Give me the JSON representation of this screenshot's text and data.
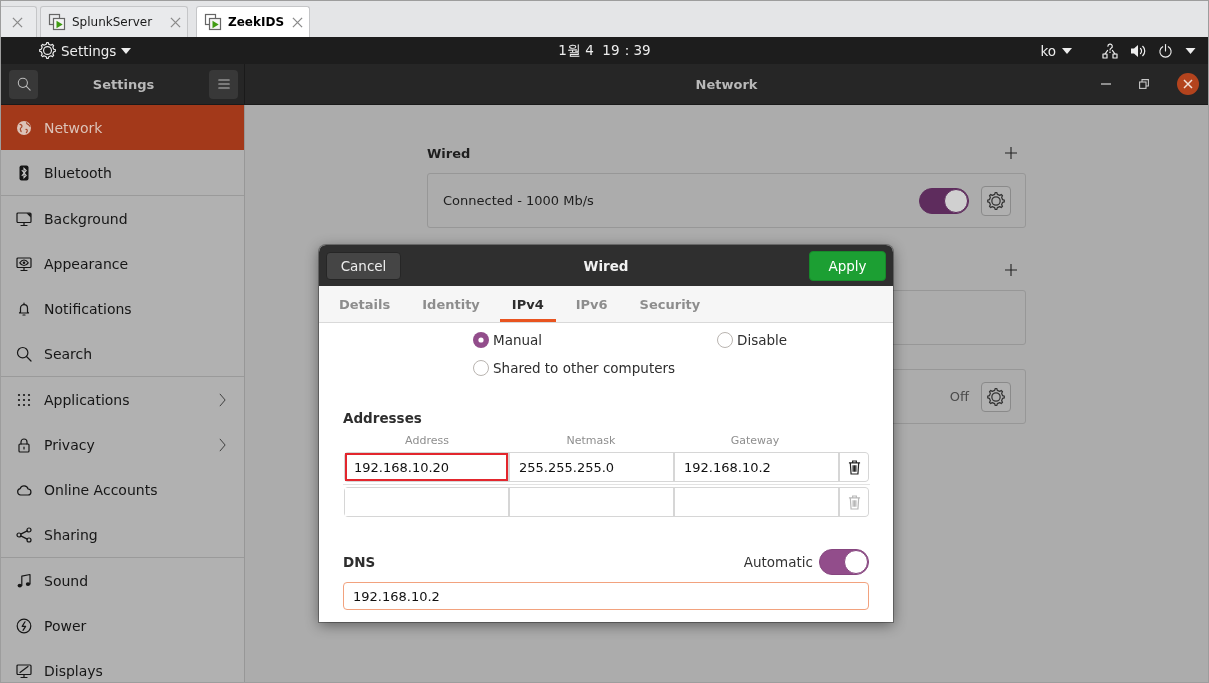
{
  "browser_tabs": [
    {
      "selected": false
    },
    {
      "label": "SplunkServer",
      "selected": false
    },
    {
      "label": "ZeekIDS",
      "selected": true
    }
  ],
  "top_bar": {
    "app_menu": "Settings",
    "clock": "1월 4  19：39",
    "keyboard_layout": "ko"
  },
  "settings": {
    "sidebar_title": "Settings",
    "page_title": "Network",
    "sidebar": {
      "groups": [
        {
          "items": [
            {
              "label": "Network",
              "selected": true,
              "has_submenu": false
            },
            {
              "label": "Bluetooth",
              "selected": false,
              "has_submenu": false
            }
          ]
        },
        {
          "items": [
            {
              "label": "Background",
              "selected": false,
              "has_submenu": false
            },
            {
              "label": "Appearance",
              "selected": false,
              "has_submenu": false
            },
            {
              "label": "Notifications",
              "selected": false,
              "has_submenu": false
            },
            {
              "label": "Search",
              "selected": false,
              "has_submenu": false
            }
          ]
        },
        {
          "items": [
            {
              "label": "Applications",
              "selected": false,
              "has_submenu": true
            },
            {
              "label": "Privacy",
              "selected": false,
              "has_submenu": true
            },
            {
              "label": "Online Accounts",
              "selected": false,
              "has_submenu": false
            },
            {
              "label": "Sharing",
              "selected": false,
              "has_submenu": false
            }
          ]
        },
        {
          "items": [
            {
              "label": "Sound",
              "selected": false,
              "has_submenu": false
            },
            {
              "label": "Power",
              "selected": false,
              "has_submenu": false
            },
            {
              "label": "Displays",
              "selected": false,
              "has_submenu": false
            }
          ]
        }
      ]
    }
  },
  "network": {
    "sections": [
      {
        "title": "Wired",
        "has_add_button": true,
        "card": {
          "kind": "toggle",
          "label": "Connected - 1000 Mb/s",
          "on": true
        }
      },
      {
        "has_add_button": true,
        "card": {
          "kind": "empty"
        }
      },
      {
        "has_add_button": false,
        "card": {
          "kind": "status",
          "status": "Off"
        }
      }
    ]
  },
  "dialog": {
    "cancel": "Cancel",
    "title": "Wired",
    "apply": "Apply",
    "tabs": [
      {
        "label": "Details",
        "selected": false
      },
      {
        "label": "Identity",
        "selected": false
      },
      {
        "label": "IPv4",
        "selected": true
      },
      {
        "label": "IPv6",
        "selected": false
      },
      {
        "label": "Security",
        "selected": false
      }
    ],
    "method_options": [
      {
        "label": "Manual",
        "selected": true
      },
      {
        "label": "Disable",
        "selected": false
      },
      {
        "label": "Shared to other computers",
        "selected": false
      }
    ],
    "addresses": {
      "title": "Addresses",
      "columns": [
        "Address",
        "Netmask",
        "Gateway"
      ],
      "rows": [
        {
          "cells": [
            {
              "value": "192.168.10.20",
              "highlighted": true
            },
            {
              "value": "255.255.255.0",
              "highlighted": false
            },
            {
              "value": "192.168.10.2",
              "highlighted": false
            }
          ],
          "delete_disabled": false
        },
        {
          "cells": [
            {
              "highlighted": false
            },
            {
              "highlighted": false
            },
            {
              "highlighted": false
            }
          ],
          "delete_disabled": true
        }
      ]
    },
    "dns": {
      "title": "DNS",
      "automatic_label": "Automatic",
      "automatic": true,
      "value": "192.168.10.2",
      "focused": true
    }
  }
}
